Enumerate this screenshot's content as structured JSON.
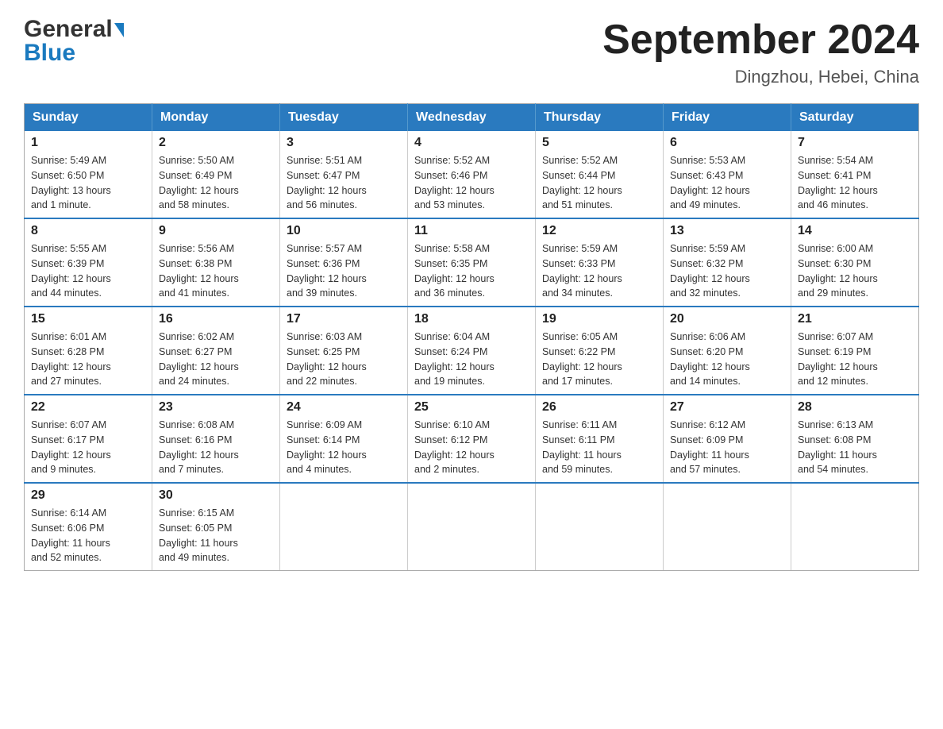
{
  "header": {
    "logo_general": "General",
    "logo_blue": "Blue",
    "title": "September 2024",
    "subtitle": "Dingzhou, Hebei, China"
  },
  "days_of_week": [
    "Sunday",
    "Monday",
    "Tuesday",
    "Wednesday",
    "Thursday",
    "Friday",
    "Saturday"
  ],
  "weeks": [
    [
      {
        "day": "1",
        "info": "Sunrise: 5:49 AM\nSunset: 6:50 PM\nDaylight: 13 hours\nand 1 minute."
      },
      {
        "day": "2",
        "info": "Sunrise: 5:50 AM\nSunset: 6:49 PM\nDaylight: 12 hours\nand 58 minutes."
      },
      {
        "day": "3",
        "info": "Sunrise: 5:51 AM\nSunset: 6:47 PM\nDaylight: 12 hours\nand 56 minutes."
      },
      {
        "day": "4",
        "info": "Sunrise: 5:52 AM\nSunset: 6:46 PM\nDaylight: 12 hours\nand 53 minutes."
      },
      {
        "day": "5",
        "info": "Sunrise: 5:52 AM\nSunset: 6:44 PM\nDaylight: 12 hours\nand 51 minutes."
      },
      {
        "day": "6",
        "info": "Sunrise: 5:53 AM\nSunset: 6:43 PM\nDaylight: 12 hours\nand 49 minutes."
      },
      {
        "day": "7",
        "info": "Sunrise: 5:54 AM\nSunset: 6:41 PM\nDaylight: 12 hours\nand 46 minutes."
      }
    ],
    [
      {
        "day": "8",
        "info": "Sunrise: 5:55 AM\nSunset: 6:39 PM\nDaylight: 12 hours\nand 44 minutes."
      },
      {
        "day": "9",
        "info": "Sunrise: 5:56 AM\nSunset: 6:38 PM\nDaylight: 12 hours\nand 41 minutes."
      },
      {
        "day": "10",
        "info": "Sunrise: 5:57 AM\nSunset: 6:36 PM\nDaylight: 12 hours\nand 39 minutes."
      },
      {
        "day": "11",
        "info": "Sunrise: 5:58 AM\nSunset: 6:35 PM\nDaylight: 12 hours\nand 36 minutes."
      },
      {
        "day": "12",
        "info": "Sunrise: 5:59 AM\nSunset: 6:33 PM\nDaylight: 12 hours\nand 34 minutes."
      },
      {
        "day": "13",
        "info": "Sunrise: 5:59 AM\nSunset: 6:32 PM\nDaylight: 12 hours\nand 32 minutes."
      },
      {
        "day": "14",
        "info": "Sunrise: 6:00 AM\nSunset: 6:30 PM\nDaylight: 12 hours\nand 29 minutes."
      }
    ],
    [
      {
        "day": "15",
        "info": "Sunrise: 6:01 AM\nSunset: 6:28 PM\nDaylight: 12 hours\nand 27 minutes."
      },
      {
        "day": "16",
        "info": "Sunrise: 6:02 AM\nSunset: 6:27 PM\nDaylight: 12 hours\nand 24 minutes."
      },
      {
        "day": "17",
        "info": "Sunrise: 6:03 AM\nSunset: 6:25 PM\nDaylight: 12 hours\nand 22 minutes."
      },
      {
        "day": "18",
        "info": "Sunrise: 6:04 AM\nSunset: 6:24 PM\nDaylight: 12 hours\nand 19 minutes."
      },
      {
        "day": "19",
        "info": "Sunrise: 6:05 AM\nSunset: 6:22 PM\nDaylight: 12 hours\nand 17 minutes."
      },
      {
        "day": "20",
        "info": "Sunrise: 6:06 AM\nSunset: 6:20 PM\nDaylight: 12 hours\nand 14 minutes."
      },
      {
        "day": "21",
        "info": "Sunrise: 6:07 AM\nSunset: 6:19 PM\nDaylight: 12 hours\nand 12 minutes."
      }
    ],
    [
      {
        "day": "22",
        "info": "Sunrise: 6:07 AM\nSunset: 6:17 PM\nDaylight: 12 hours\nand 9 minutes."
      },
      {
        "day": "23",
        "info": "Sunrise: 6:08 AM\nSunset: 6:16 PM\nDaylight: 12 hours\nand 7 minutes."
      },
      {
        "day": "24",
        "info": "Sunrise: 6:09 AM\nSunset: 6:14 PM\nDaylight: 12 hours\nand 4 minutes."
      },
      {
        "day": "25",
        "info": "Sunrise: 6:10 AM\nSunset: 6:12 PM\nDaylight: 12 hours\nand 2 minutes."
      },
      {
        "day": "26",
        "info": "Sunrise: 6:11 AM\nSunset: 6:11 PM\nDaylight: 11 hours\nand 59 minutes."
      },
      {
        "day": "27",
        "info": "Sunrise: 6:12 AM\nSunset: 6:09 PM\nDaylight: 11 hours\nand 57 minutes."
      },
      {
        "day": "28",
        "info": "Sunrise: 6:13 AM\nSunset: 6:08 PM\nDaylight: 11 hours\nand 54 minutes."
      }
    ],
    [
      {
        "day": "29",
        "info": "Sunrise: 6:14 AM\nSunset: 6:06 PM\nDaylight: 11 hours\nand 52 minutes."
      },
      {
        "day": "30",
        "info": "Sunrise: 6:15 AM\nSunset: 6:05 PM\nDaylight: 11 hours\nand 49 minutes."
      },
      null,
      null,
      null,
      null,
      null
    ]
  ]
}
